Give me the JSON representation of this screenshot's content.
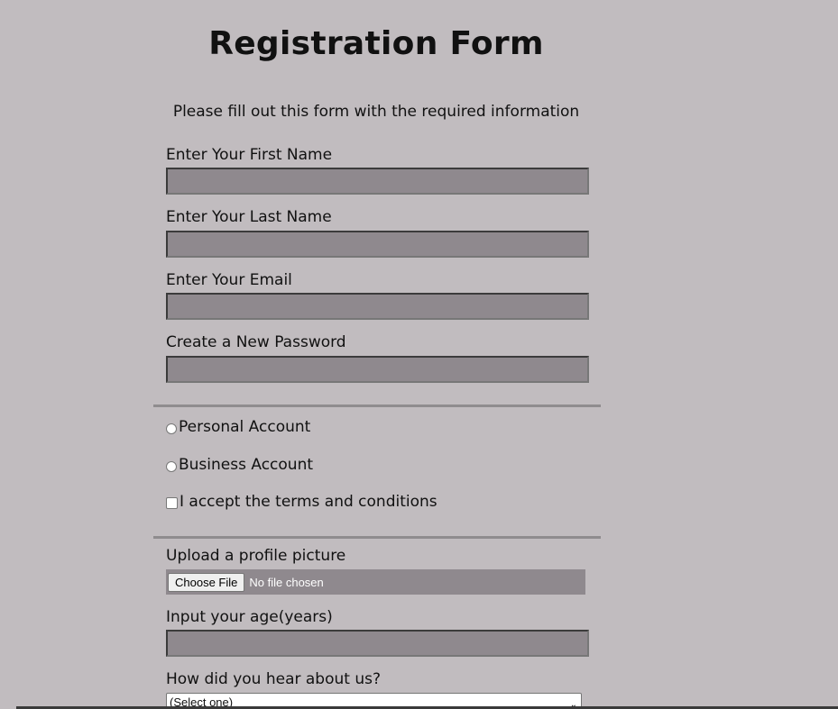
{
  "page": {
    "title": "Registration Form",
    "subtitle": "Please fill out this form with the required information"
  },
  "fields": {
    "first_name": {
      "label": "Enter Your First Name",
      "value": ""
    },
    "last_name": {
      "label": "Enter Your Last Name",
      "value": ""
    },
    "email": {
      "label": "Enter Your Email",
      "value": ""
    },
    "password": {
      "label": "Create a New Password",
      "value": ""
    }
  },
  "account_type": {
    "personal": "Personal Account",
    "business": "Business Account"
  },
  "terms": {
    "label": "I accept the terms and conditions",
    "checked": false
  },
  "upload": {
    "label": "Upload a profile picture",
    "button": "Choose File",
    "status": "No file chosen"
  },
  "age": {
    "label": "Input your age(years)",
    "value": ""
  },
  "referral": {
    "label": "How did you hear about us?",
    "selected": "(Select one)"
  },
  "colors": {
    "background": "#c1bcbf",
    "field": "#8f898e"
  }
}
